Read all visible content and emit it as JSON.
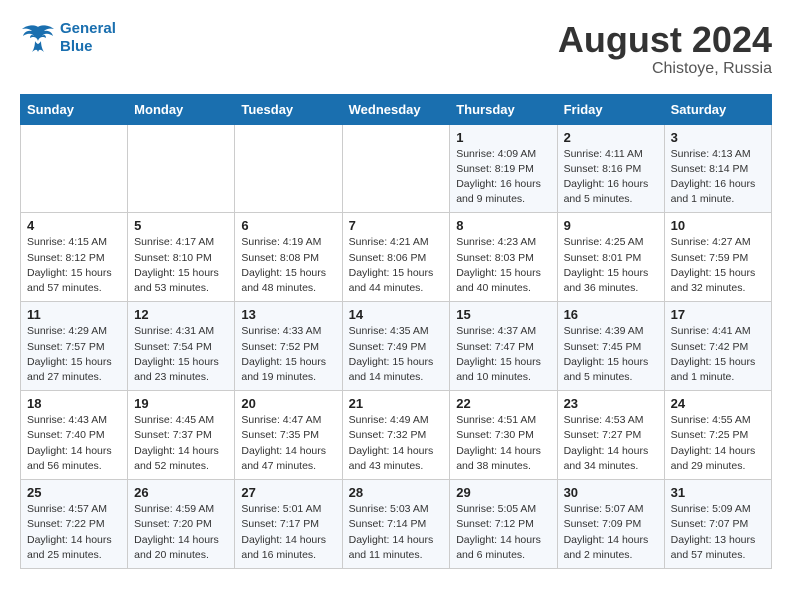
{
  "header": {
    "logo_line1": "General",
    "logo_line2": "Blue",
    "month": "August 2024",
    "location": "Chistoye, Russia"
  },
  "weekdays": [
    "Sunday",
    "Monday",
    "Tuesday",
    "Wednesday",
    "Thursday",
    "Friday",
    "Saturday"
  ],
  "weeks": [
    [
      {
        "day": "",
        "text": ""
      },
      {
        "day": "",
        "text": ""
      },
      {
        "day": "",
        "text": ""
      },
      {
        "day": "",
        "text": ""
      },
      {
        "day": "1",
        "text": "Sunrise: 4:09 AM\nSunset: 8:19 PM\nDaylight: 16 hours and 9 minutes."
      },
      {
        "day": "2",
        "text": "Sunrise: 4:11 AM\nSunset: 8:16 PM\nDaylight: 16 hours and 5 minutes."
      },
      {
        "day": "3",
        "text": "Sunrise: 4:13 AM\nSunset: 8:14 PM\nDaylight: 16 hours and 1 minute."
      }
    ],
    [
      {
        "day": "4",
        "text": "Sunrise: 4:15 AM\nSunset: 8:12 PM\nDaylight: 15 hours and 57 minutes."
      },
      {
        "day": "5",
        "text": "Sunrise: 4:17 AM\nSunset: 8:10 PM\nDaylight: 15 hours and 53 minutes."
      },
      {
        "day": "6",
        "text": "Sunrise: 4:19 AM\nSunset: 8:08 PM\nDaylight: 15 hours and 48 minutes."
      },
      {
        "day": "7",
        "text": "Sunrise: 4:21 AM\nSunset: 8:06 PM\nDaylight: 15 hours and 44 minutes."
      },
      {
        "day": "8",
        "text": "Sunrise: 4:23 AM\nSunset: 8:03 PM\nDaylight: 15 hours and 40 minutes."
      },
      {
        "day": "9",
        "text": "Sunrise: 4:25 AM\nSunset: 8:01 PM\nDaylight: 15 hours and 36 minutes."
      },
      {
        "day": "10",
        "text": "Sunrise: 4:27 AM\nSunset: 7:59 PM\nDaylight: 15 hours and 32 minutes."
      }
    ],
    [
      {
        "day": "11",
        "text": "Sunrise: 4:29 AM\nSunset: 7:57 PM\nDaylight: 15 hours and 27 minutes."
      },
      {
        "day": "12",
        "text": "Sunrise: 4:31 AM\nSunset: 7:54 PM\nDaylight: 15 hours and 23 minutes."
      },
      {
        "day": "13",
        "text": "Sunrise: 4:33 AM\nSunset: 7:52 PM\nDaylight: 15 hours and 19 minutes."
      },
      {
        "day": "14",
        "text": "Sunrise: 4:35 AM\nSunset: 7:49 PM\nDaylight: 15 hours and 14 minutes."
      },
      {
        "day": "15",
        "text": "Sunrise: 4:37 AM\nSunset: 7:47 PM\nDaylight: 15 hours and 10 minutes."
      },
      {
        "day": "16",
        "text": "Sunrise: 4:39 AM\nSunset: 7:45 PM\nDaylight: 15 hours and 5 minutes."
      },
      {
        "day": "17",
        "text": "Sunrise: 4:41 AM\nSunset: 7:42 PM\nDaylight: 15 hours and 1 minute."
      }
    ],
    [
      {
        "day": "18",
        "text": "Sunrise: 4:43 AM\nSunset: 7:40 PM\nDaylight: 14 hours and 56 minutes."
      },
      {
        "day": "19",
        "text": "Sunrise: 4:45 AM\nSunset: 7:37 PM\nDaylight: 14 hours and 52 minutes."
      },
      {
        "day": "20",
        "text": "Sunrise: 4:47 AM\nSunset: 7:35 PM\nDaylight: 14 hours and 47 minutes."
      },
      {
        "day": "21",
        "text": "Sunrise: 4:49 AM\nSunset: 7:32 PM\nDaylight: 14 hours and 43 minutes."
      },
      {
        "day": "22",
        "text": "Sunrise: 4:51 AM\nSunset: 7:30 PM\nDaylight: 14 hours and 38 minutes."
      },
      {
        "day": "23",
        "text": "Sunrise: 4:53 AM\nSunset: 7:27 PM\nDaylight: 14 hours and 34 minutes."
      },
      {
        "day": "24",
        "text": "Sunrise: 4:55 AM\nSunset: 7:25 PM\nDaylight: 14 hours and 29 minutes."
      }
    ],
    [
      {
        "day": "25",
        "text": "Sunrise: 4:57 AM\nSunset: 7:22 PM\nDaylight: 14 hours and 25 minutes."
      },
      {
        "day": "26",
        "text": "Sunrise: 4:59 AM\nSunset: 7:20 PM\nDaylight: 14 hours and 20 minutes."
      },
      {
        "day": "27",
        "text": "Sunrise: 5:01 AM\nSunset: 7:17 PM\nDaylight: 14 hours and 16 minutes."
      },
      {
        "day": "28",
        "text": "Sunrise: 5:03 AM\nSunset: 7:14 PM\nDaylight: 14 hours and 11 minutes."
      },
      {
        "day": "29",
        "text": "Sunrise: 5:05 AM\nSunset: 7:12 PM\nDaylight: 14 hours and 6 minutes."
      },
      {
        "day": "30",
        "text": "Sunrise: 5:07 AM\nSunset: 7:09 PM\nDaylight: 14 hours and 2 minutes."
      },
      {
        "day": "31",
        "text": "Sunrise: 5:09 AM\nSunset: 7:07 PM\nDaylight: 13 hours and 57 minutes."
      }
    ]
  ]
}
